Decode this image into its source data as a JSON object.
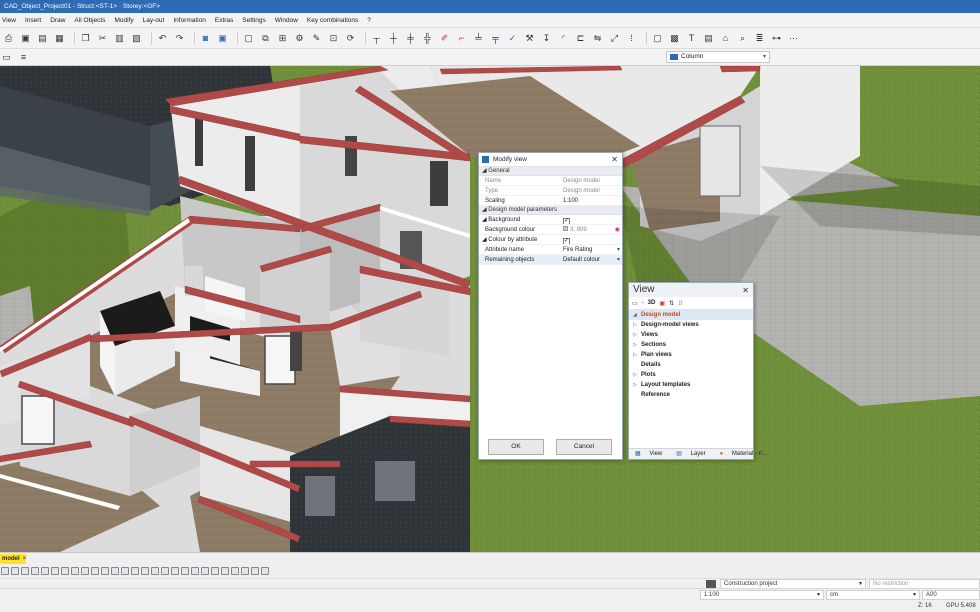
{
  "window": {
    "title": "CAD_Object_Project01 - Struct:<ST-1> · Storey:<GF>"
  },
  "menu": [
    "View",
    "Insert",
    "Draw",
    "All Objects",
    "Modify",
    "Lay-out",
    "Information",
    "Extras",
    "Settings",
    "Window",
    "Key combinations",
    "?"
  ],
  "toolbar": {
    "layer_combo": "Column",
    "icons": [
      "print-icon",
      "save-icon",
      "open-icon",
      "copy-icon",
      "cut-icon",
      "paste-icon",
      "undo-icon",
      "redo-icon",
      "view-icon",
      "select-icon"
    ]
  },
  "modify_view": {
    "title": "Modify view",
    "sections": {
      "general": "General",
      "design_params": "Design model parameters"
    },
    "general_rows": [
      {
        "key": "Name",
        "value": "Design model"
      },
      {
        "key": "Type",
        "value": "Design model"
      },
      {
        "key": "Scaling",
        "value": "1:100"
      }
    ],
    "background": {
      "label": "Background",
      "checked": "✓"
    },
    "background_colour": {
      "label": "Background colour",
      "value": "3, 809"
    },
    "colour_by_attribute": {
      "label": "Colour by attribute",
      "checked": "✓"
    },
    "attribute_name": {
      "label": "Attribute name",
      "value": "Fire Rating"
    },
    "remaining_objects": {
      "label": "Remaining objects",
      "value": "Default colour"
    },
    "ok_label": "OK",
    "cancel_label": "Cancel"
  },
  "view_palette": {
    "title": "View",
    "toolbar_3d": "3D",
    "tree": [
      "Design model",
      "Design-model views",
      "Views",
      "Sections",
      "Plan views",
      "Details",
      "Plots",
      "Layout templates",
      "Reference"
    ],
    "tabs": [
      "View",
      "Layer",
      "Material - r/..."
    ]
  },
  "bottom": {
    "tab_label": "model",
    "tab_close": "×",
    "project_type": "Construction project",
    "restriction": "No restriction",
    "scale": "1:100",
    "unit": "cm",
    "layer": "A00",
    "coord": "Z: 16",
    "gpu": "GPU 5.408"
  },
  "colors": {
    "titlebar": "#2d6bb5",
    "grass": "#6f8f3a",
    "brick_top": "#b04a48",
    "floor_wood": "#8e7c66",
    "wall": "#e7e7e7",
    "tab_highlight": "#ffe12d",
    "tree_selected": "#c34a1a"
  }
}
